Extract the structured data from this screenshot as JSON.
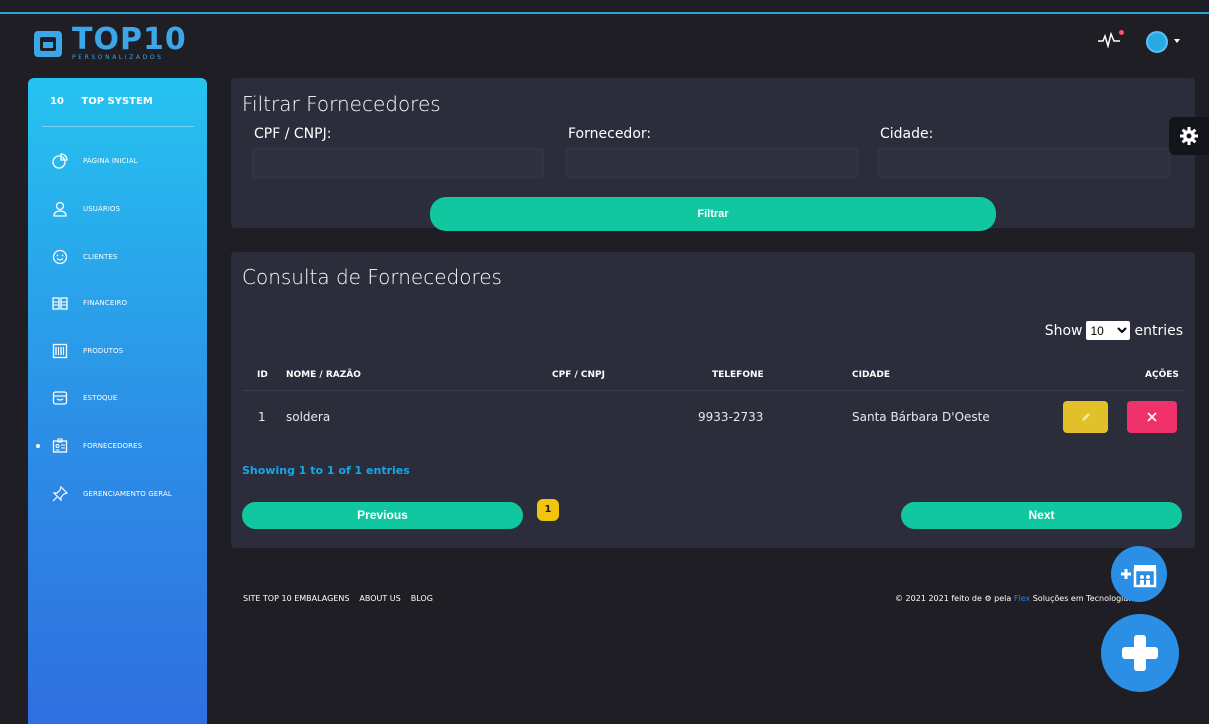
{
  "header": {
    "logo_main": "TOP10",
    "logo_sub": "PERSONALIZADOS"
  },
  "sidebar": {
    "brand_num": "10",
    "brand_name": "TOP SYSTEM",
    "items": [
      {
        "label": "PÁGINA INICIAL",
        "icon": "pie-chart-icon"
      },
      {
        "label": "USUÁRIOS",
        "icon": "user-icon"
      },
      {
        "label": "CLIENTES",
        "icon": "smile-icon"
      },
      {
        "label": "FINANCEIRO",
        "icon": "money-icon"
      },
      {
        "label": "PRODUTOS",
        "icon": "barcode-icon"
      },
      {
        "label": "ESTOQUE",
        "icon": "box-icon"
      },
      {
        "label": "FORNECEDORES",
        "icon": "id-card-icon",
        "active": true
      },
      {
        "label": "GERENCIAMENTO GERAL",
        "icon": "pin-icon"
      }
    ]
  },
  "filter": {
    "title": "Filtrar Fornecedores",
    "cpf_label": "CPF / CNPJ:",
    "cpf_value": "",
    "fornecedor_label": "Fornecedor:",
    "fornecedor_value": "",
    "cidade_label": "Cidade:",
    "cidade_value": "",
    "button": "Filtrar"
  },
  "consulta": {
    "title": "Consulta de Fornecedores",
    "show_prefix": "Show",
    "show_value": "10",
    "show_suffix": "entries",
    "columns": [
      "ID",
      "NOME / RAZÃO",
      "CPF / CNPJ",
      "TELEFONE",
      "CIDADE",
      "AÇÕES"
    ],
    "rows": [
      {
        "id": "1",
        "nome": "soldera",
        "cpf": "",
        "telefone": "9933-2733",
        "cidade": "Santa Bárbara D'Oeste"
      }
    ],
    "showing": "Showing 1 to 1 of 1 entries",
    "prev": "Previous",
    "page": "1",
    "next": "Next"
  },
  "footer": {
    "links": [
      "SITE TOP 10 EMBALAGENS",
      "ABOUT US",
      "BLOG"
    ],
    "copy_before": "© 2021 2021 feito de ",
    "copy_mid": " pela ",
    "copy_flex": "Flex",
    "copy_after": " Soluções em Tecnologia."
  },
  "colors": {
    "accent_green": "#11c79f",
    "accent_blue": "#2c8fe6",
    "edit_yellow": "#e2c02a",
    "delete_red": "#f0326b"
  }
}
